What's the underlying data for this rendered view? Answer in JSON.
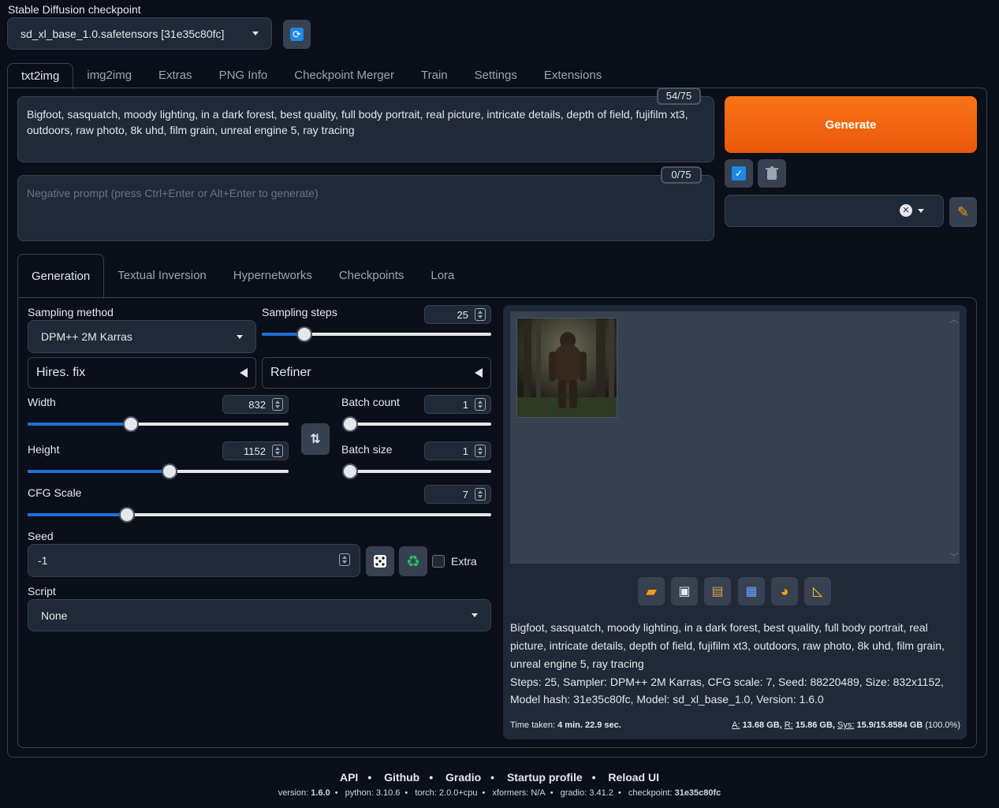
{
  "checkpoint": {
    "label": "Stable Diffusion checkpoint",
    "value": "sd_xl_base_1.0.safetensors [31e35c80fc]"
  },
  "tabs": [
    "txt2img",
    "img2img",
    "Extras",
    "PNG Info",
    "Checkpoint Merger",
    "Train",
    "Settings",
    "Extensions"
  ],
  "prompt": {
    "text": "Bigfoot, sasquatch, moody lighting, in a dark forest, best quality, full body portrait, real picture, intricate details, depth of field, fujifilm xt3, outdoors, raw photo, 8k uhd, film grain, unreal engine 5, ray tracing",
    "counter": "54/75"
  },
  "negative": {
    "placeholder": "Negative prompt (press Ctrl+Enter or Alt+Enter to generate)",
    "counter": "0/75"
  },
  "generate_label": "Generate",
  "subtabs": [
    "Generation",
    "Textual Inversion",
    "Hypernetworks",
    "Checkpoints",
    "Lora"
  ],
  "sampling": {
    "method_label": "Sampling method",
    "method_value": "DPM++ 2M Karras",
    "steps_label": "Sampling steps",
    "steps_value": "25"
  },
  "hires_label": "Hires. fix",
  "refiner_label": "Refiner",
  "width": {
    "label": "Width",
    "value": "832"
  },
  "height": {
    "label": "Height",
    "value": "1152"
  },
  "batch_count": {
    "label": "Batch count",
    "value": "1"
  },
  "batch_size": {
    "label": "Batch size",
    "value": "1"
  },
  "cfg": {
    "label": "CFG Scale",
    "value": "7"
  },
  "seed": {
    "label": "Seed",
    "value": "-1",
    "extra_label": "Extra"
  },
  "script": {
    "label": "Script",
    "value": "None"
  },
  "output": {
    "info_text": "Bigfoot, sasquatch, moody lighting, in a dark forest, best quality, full body portrait, real picture, intricate details, depth of field, fujifilm xt3, outdoors, raw photo, 8k uhd, film grain, unreal engine 5, ray tracing",
    "params": "Steps: 25, Sampler: DPM++ 2M Karras, CFG scale: 7, Seed: 88220489, Size: 832x1152, Model hash: 31e35c80fc, Model: sd_xl_base_1.0, Version: 1.6.0",
    "time_label": "Time taken:",
    "time_value": "4 min. 22.9 sec.",
    "mem_a_label": "A:",
    "mem_a": "13.68 GB,",
    "mem_r_label": "R:",
    "mem_r": "15.86 GB,",
    "mem_sys_label": "Sys:",
    "mem_sys": "15.9/15.8584 GB",
    "mem_pct": "(100.0%)"
  },
  "footer": {
    "links": [
      "API",
      "Github",
      "Gradio",
      "Startup profile",
      "Reload UI"
    ],
    "versions": [
      {
        "k": "version:",
        "v": "1.6.0"
      },
      {
        "k": "python:",
        "v": "3.10.6"
      },
      {
        "k": "torch:",
        "v": "2.0.0+cpu"
      },
      {
        "k": "xformers:",
        "v": "N/A"
      },
      {
        "k": "gradio:",
        "v": "3.41.2"
      },
      {
        "k": "checkpoint:",
        "v": "31e35c80fc"
      }
    ]
  },
  "colors": {
    "accent": "#ea580c",
    "slider": "#1e6fdc",
    "bg": "#0b0f19",
    "panel": "#1f2937"
  },
  "slider_levels": {
    "sampling_steps": 0.185,
    "width": 0.395,
    "height": 0.545,
    "batch_count": 0.0,
    "batch_size": 0.0,
    "cfg": 0.215
  }
}
